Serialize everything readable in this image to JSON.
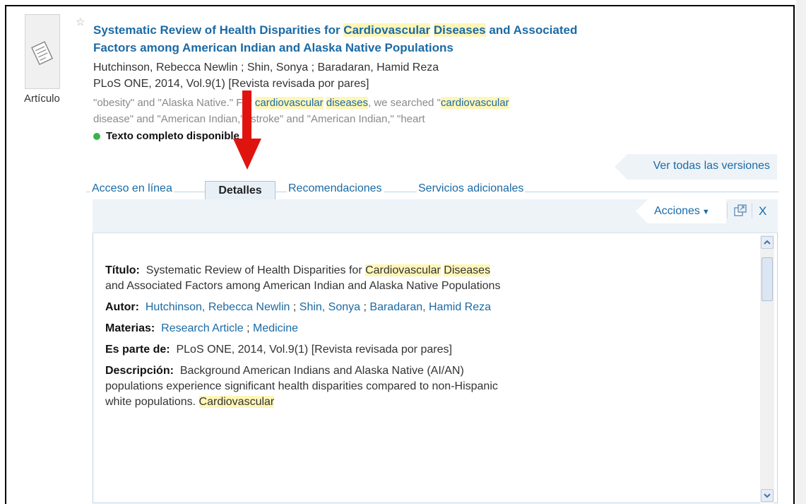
{
  "record": {
    "type_label": "Artículo",
    "title_parts": [
      "Systematic Review of Health Disparities for ",
      "Cardiovascular",
      " ",
      "Diseases",
      " and Associated",
      "Factors among American Indian and Alaska Native Populations"
    ],
    "authors": "Hutchinson, Rebecca Newlin ; Shin, Sonya ; Baradaran, Hamid Reza",
    "source": "PLoS ONE, 2014, Vol.9(1) [Revista revisada por pares]",
    "snippet_parts": [
      "\"obesity\" and \"Alaska Native.\" For ",
      "cardiovascular",
      " ",
      "diseases",
      ", we searched \"",
      "cardiovascular",
      "disease\" and \"American Indian,\" \"stroke\" and \"American Indian,\" \"heart"
    ],
    "availability": "Texto completo disponible",
    "all_versions": "Ver todas las versiones"
  },
  "tabs": {
    "online": "Acceso en línea",
    "details": "Detalles",
    "recommendations": "Recomendaciones",
    "services": "Servicios adicionales"
  },
  "toolbar": {
    "actions_label": "Acciones",
    "close_label": "X"
  },
  "details": {
    "title_label": "Título:",
    "title_parts": [
      "Systematic Review of Health Disparities for ",
      "Cardiovascular",
      "Diseases",
      " and Associated Factors among American Indian and Alaska Native Populations"
    ],
    "author_label": "Autor:",
    "authors": [
      "Hutchinson, Rebecca Newlin",
      "Shin, Sonya",
      "Baradaran, Hamid Reza"
    ],
    "subjects_label": "Materias:",
    "subjects": [
      "Research Article",
      "Medicine"
    ],
    "part_of_label": "Es parte de:",
    "part_of": "PLoS ONE, 2014, Vol.9(1) [Revista revisada por pares]",
    "description_label": "Descripción:",
    "description_parts": [
      "Background American Indians and Alaska Native (AI/AN) populations experience significant health disparities compared to non-Hispanic white populations. ",
      "Cardiovascular"
    ]
  },
  "colors": {
    "link": "#1b6aa5",
    "highlight": "#fff6b8",
    "annotation_arrow": "#e0140f",
    "available_dot": "#3bb24a"
  }
}
